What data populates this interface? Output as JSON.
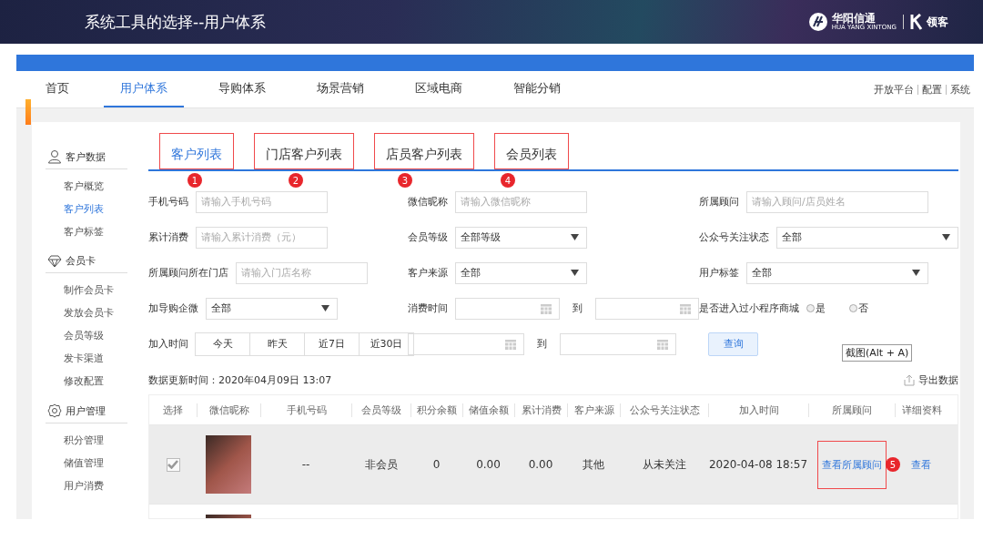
{
  "slide": {
    "title": "系统工具的选择--用户体系",
    "logo": {
      "brand": "华阳信通",
      "brand_sub": "HUA YANG XINTONG",
      "partner": "领客"
    }
  },
  "nav": {
    "items": [
      {
        "label": "首页",
        "selected": false
      },
      {
        "label": "用户体系",
        "selected": true
      },
      {
        "label": "导购体系",
        "selected": false
      },
      {
        "label": "场景营销",
        "selected": false
      },
      {
        "label": "区域电商",
        "selected": false
      },
      {
        "label": "智能分销",
        "selected": false
      }
    ],
    "links": [
      "开放平台",
      "配置",
      "系统"
    ]
  },
  "sidebar": [
    {
      "title": "客户数据",
      "kind": "person",
      "items": [
        {
          "label": "客户概览",
          "selected": false
        },
        {
          "label": "客户列表",
          "selected": true
        },
        {
          "label": "客户标签",
          "selected": false
        }
      ]
    },
    {
      "title": "会员卡",
      "kind": "diamond",
      "items": [
        {
          "label": "制作会员卡",
          "selected": false
        },
        {
          "label": "发放会员卡",
          "selected": false
        },
        {
          "label": "会员等级",
          "selected": false
        },
        {
          "label": "发卡渠道",
          "selected": false
        },
        {
          "label": "修改配置",
          "selected": false
        }
      ]
    },
    {
      "title": "用户管理",
      "kind": "gear",
      "items": [
        {
          "label": "积分管理",
          "selected": false
        },
        {
          "label": "储值管理",
          "selected": false
        },
        {
          "label": "用户消费",
          "selected": false
        }
      ]
    }
  ],
  "tabs": [
    {
      "label": "客户列表",
      "selected": true,
      "callout": "1"
    },
    {
      "label": "门店客户列表",
      "selected": false,
      "callout": "2"
    },
    {
      "label": "店员客户列表",
      "selected": false,
      "callout": "3"
    },
    {
      "label": "会员列表",
      "selected": false,
      "callout": "4"
    }
  ],
  "form": {
    "rows": [
      [
        {
          "kind": "text",
          "label": "手机号码",
          "placeholder": "请输入手机号码"
        },
        {
          "kind": "text",
          "label": "微信昵称",
          "placeholder": "请输入微信昵称"
        },
        {
          "kind": "text",
          "label": "所属顾问",
          "placeholder": "请输入顾问/店员姓名"
        }
      ],
      [
        {
          "kind": "text",
          "label": "累计消费",
          "placeholder": "请输入累计消费（元）"
        },
        {
          "kind": "select",
          "label": "会员等级",
          "value": "全部等级"
        },
        {
          "kind": "select",
          "label": "公众号关注状态",
          "value": "全部"
        }
      ],
      [
        {
          "kind": "text",
          "label": "所属顾问所在门店",
          "placeholder": "请输入门店名称"
        },
        {
          "kind": "select",
          "label": "客户来源",
          "value": "全部"
        },
        {
          "kind": "select",
          "label": "用户标签",
          "value": "全部"
        }
      ],
      [
        {
          "kind": "select",
          "label": "加导购企微",
          "value": "全部"
        },
        {
          "kind": "date-range",
          "label": "消费时间",
          "separator": "到"
        },
        {
          "kind": "radio",
          "label": "是否进入过小程序商城",
          "options": [
            {
              "label": "是",
              "selected": false
            },
            {
              "label": "否",
              "selected": false
            }
          ]
        }
      ],
      [
        {
          "kind": "quick",
          "label": "加入时间",
          "options": [
            {
              "label": "今天",
              "selected": false
            },
            {
              "label": "昨天",
              "selected": false
            },
            {
              "label": "近7日",
              "selected": false
            },
            {
              "label": "近30日",
              "selected": false
            }
          ]
        },
        {
          "kind": "date-range",
          "separator": "到"
        },
        {
          "kind": "button",
          "label": "查询"
        }
      ]
    ]
  },
  "tooltip": "截图(Alt + A)",
  "update_time": "数据更新时间：2020年04月09日 13:07",
  "export": "导出数据",
  "table": {
    "columns": [
      "选择",
      "微信昵称",
      "手机号码",
      "会员等级",
      "积分余额",
      "储值余额",
      "累计消费",
      "客户来源",
      "公众号关注状态",
      "加入时间",
      "所属顾问",
      "详细资料"
    ],
    "rows": [
      {
        "highlighted": true,
        "cells": [
          {
            "kind": "checkbox",
            "checked": true,
            "disabled": true
          },
          {
            "kind": "photo"
          },
          {
            "kind": "text",
            "value": "--"
          },
          {
            "kind": "text",
            "value": "非会员"
          },
          {
            "kind": "text",
            "value": "0"
          },
          {
            "kind": "text",
            "value": "0.00"
          },
          {
            "kind": "text",
            "value": "0.00"
          },
          {
            "kind": "text",
            "value": "其他"
          },
          {
            "kind": "text",
            "value": "从未关注"
          },
          {
            "kind": "text",
            "value": "2020-04-08 18:57"
          },
          {
            "kind": "link",
            "value": "查看所属顾问",
            "callout": "5"
          },
          {
            "kind": "link",
            "value": "查看"
          }
        ]
      },
      {
        "highlighted": false,
        "cells": [
          {
            "kind": "blank"
          },
          {
            "kind": "photo"
          }
        ]
      }
    ]
  }
}
